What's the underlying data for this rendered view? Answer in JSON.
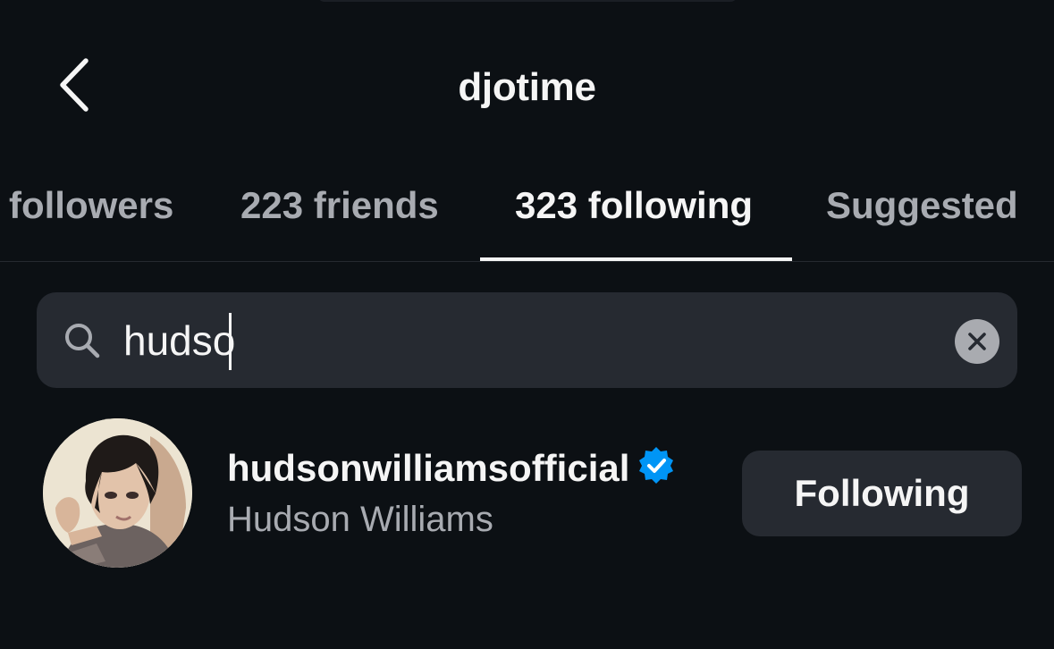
{
  "header": {
    "title": "djotime",
    "back_icon": "chevron-left-icon"
  },
  "tabs": [
    {
      "label": "followers",
      "active": false
    },
    {
      "label": "223 friends",
      "active": false
    },
    {
      "label": "323 following",
      "active": true
    },
    {
      "label": "Suggested",
      "active": false
    }
  ],
  "search": {
    "value": "hudso",
    "icon": "search-icon",
    "clear_icon": "close-icon"
  },
  "results": [
    {
      "username": "hudsonwilliamsofficial",
      "verified": true,
      "full_name": "Hudson Williams",
      "button_label": "Following"
    }
  ],
  "colors": {
    "background": "#0c1014",
    "surface": "#262a31",
    "text_primary": "#f5f5f5",
    "text_secondary": "#a8abb1",
    "verified_blue": "#0095f6"
  }
}
